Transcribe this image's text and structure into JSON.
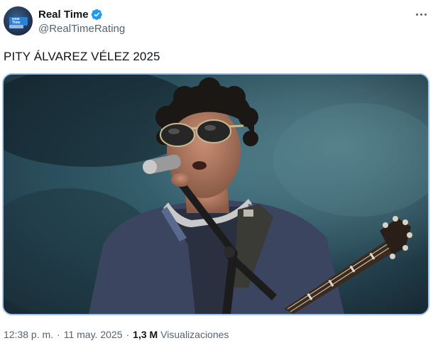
{
  "author": {
    "display_name": "Real Time",
    "handle": "@RealTimeRating",
    "avatar_text": "Real Time",
    "verified": true
  },
  "tweet": {
    "text": "PITY ÁLVAREZ VÉLEZ 2025"
  },
  "meta": {
    "time": "12:38 p. m.",
    "separator": "·",
    "date": "11 may. 2025",
    "views_count": "1,3 M",
    "views_label": "Visualizaciones"
  },
  "colors": {
    "verified": "#1d9bf0",
    "secondary_text": "#536471",
    "media_border": "#9ec6ee"
  },
  "icons": {
    "verified": "verified-badge-icon",
    "more": "more-options-icon"
  }
}
